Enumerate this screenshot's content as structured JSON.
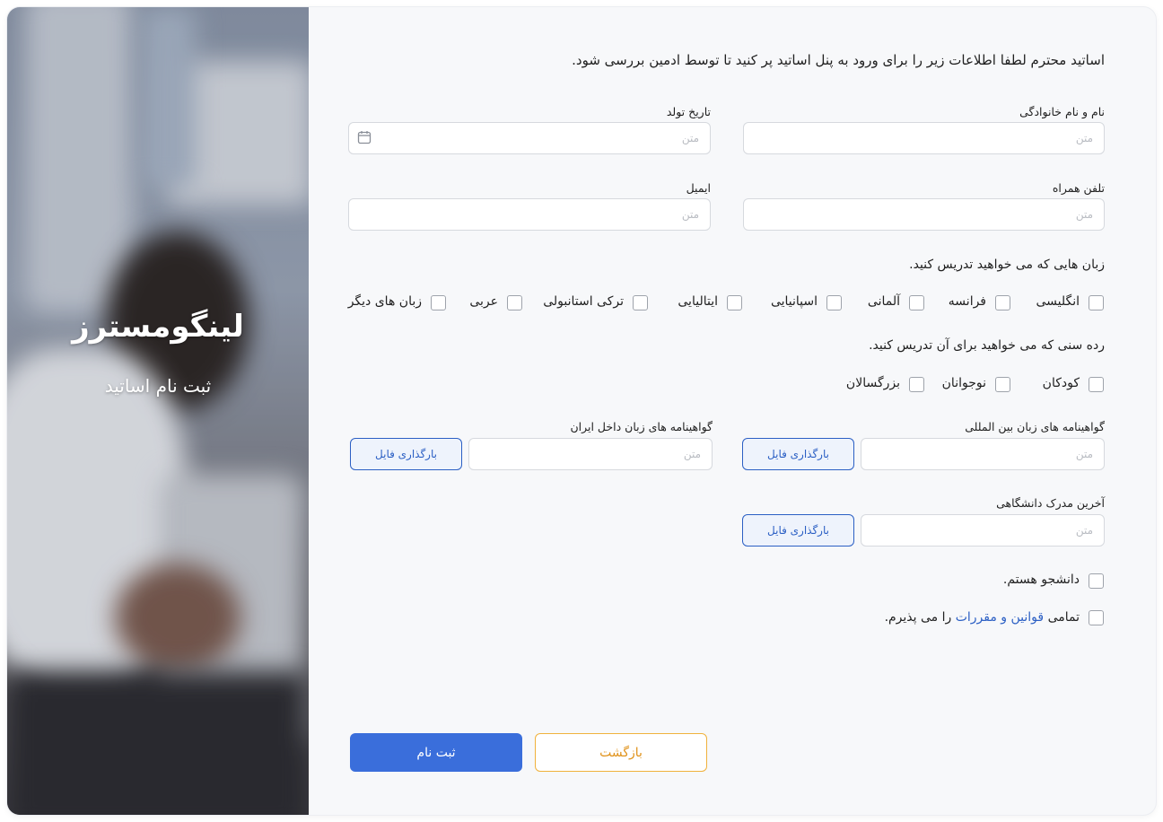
{
  "hero": {
    "brand": "لینگومسترز",
    "subtitle": "ثبت نام اساتید"
  },
  "intro": "اساتید محترم لطفا اطلاعات زیر را برای ورود به پنل اساتید پر کنید تا توسط ادمین بررسی شود.",
  "fields": {
    "full_name": {
      "label": "نام و نام خانوادگی",
      "placeholder": "متن"
    },
    "birth_date": {
      "label": "تاریخ تولد",
      "placeholder": "متن"
    },
    "mobile": {
      "label": "تلفن همراه",
      "placeholder": "متن"
    },
    "email": {
      "label": "ایمیل",
      "placeholder": "متن"
    },
    "intl_certs": {
      "label": "گواهینامه های زبان بین المللی",
      "placeholder": "متن"
    },
    "iran_certs": {
      "label": "گواهینامه های زبان داخل ایران",
      "placeholder": "متن"
    },
    "last_degree": {
      "label": "آخرین مدرک دانشگاهی",
      "placeholder": "متن"
    }
  },
  "upload_label": "بارگذاری فایل",
  "languages": {
    "title": "زبان هایی که می خواهید تدریس کنید.",
    "options": [
      "انگلیسی",
      "فرانسه",
      "آلمانی",
      "اسپانیایی",
      "ایتالیایی",
      "ترکی استانبولی",
      "عربی",
      "زبان های دیگر"
    ]
  },
  "age_groups": {
    "title": "رده سنی که می خواهید برای آن تدریس کنید.",
    "options": [
      "کودکان",
      "نوجوانان",
      "بزرگسالان"
    ]
  },
  "student": "دانشجو هستم.",
  "terms": {
    "prefix": "تمامی",
    "link": "قوانین و مقررات",
    "suffix": "را می پذیرم."
  },
  "buttons": {
    "submit": "ثبت نام",
    "back": "بازگشت"
  },
  "colors": {
    "primary": "#3a6edb",
    "accent": "#f0b23c",
    "link": "#2b5fc4"
  }
}
